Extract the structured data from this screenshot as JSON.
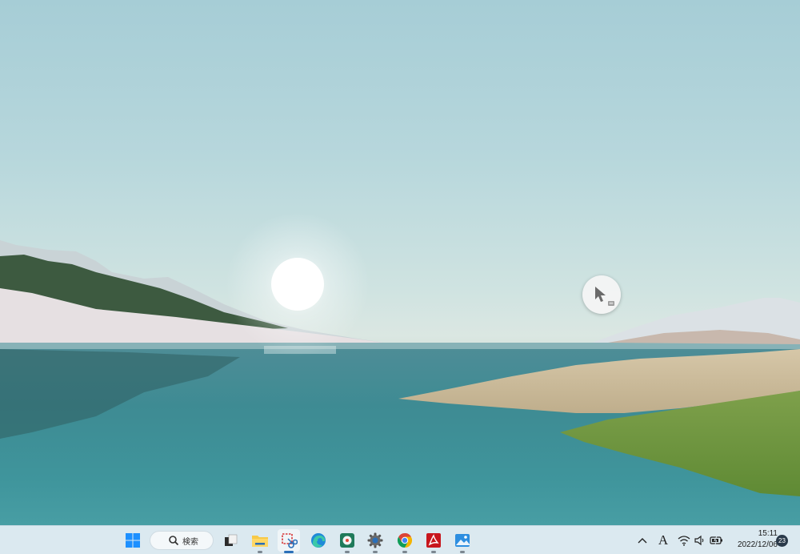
{
  "desktop": {
    "wallpaper": "lake-landscape-with-sun"
  },
  "taskbar": {
    "search_label": "検索",
    "apps": [
      {
        "name": "start-button",
        "icon": "windows-logo-icon"
      },
      {
        "name": "task-view",
        "icon": "task-view-icon"
      },
      {
        "name": "file-explorer",
        "icon": "folder-icon"
      },
      {
        "name": "snipping-tool",
        "icon": "snipping-tool-icon",
        "active": true
      },
      {
        "name": "edge-browser",
        "icon": "edge-icon"
      },
      {
        "name": "app-green",
        "icon": "green-app-icon"
      },
      {
        "name": "settings",
        "icon": "gear-icon"
      },
      {
        "name": "chrome",
        "icon": "chrome-icon"
      },
      {
        "name": "acrobat",
        "icon": "pdf-icon"
      },
      {
        "name": "photos",
        "icon": "photos-icon"
      }
    ],
    "tray": {
      "ime": "A",
      "time": "15:11",
      "date": "2022/12/06",
      "notifications": "23"
    }
  },
  "colors": {
    "accent": "#2a6fb8",
    "taskbar_bg": "#dbe9f0",
    "windows_blue": "#1e90ff"
  }
}
